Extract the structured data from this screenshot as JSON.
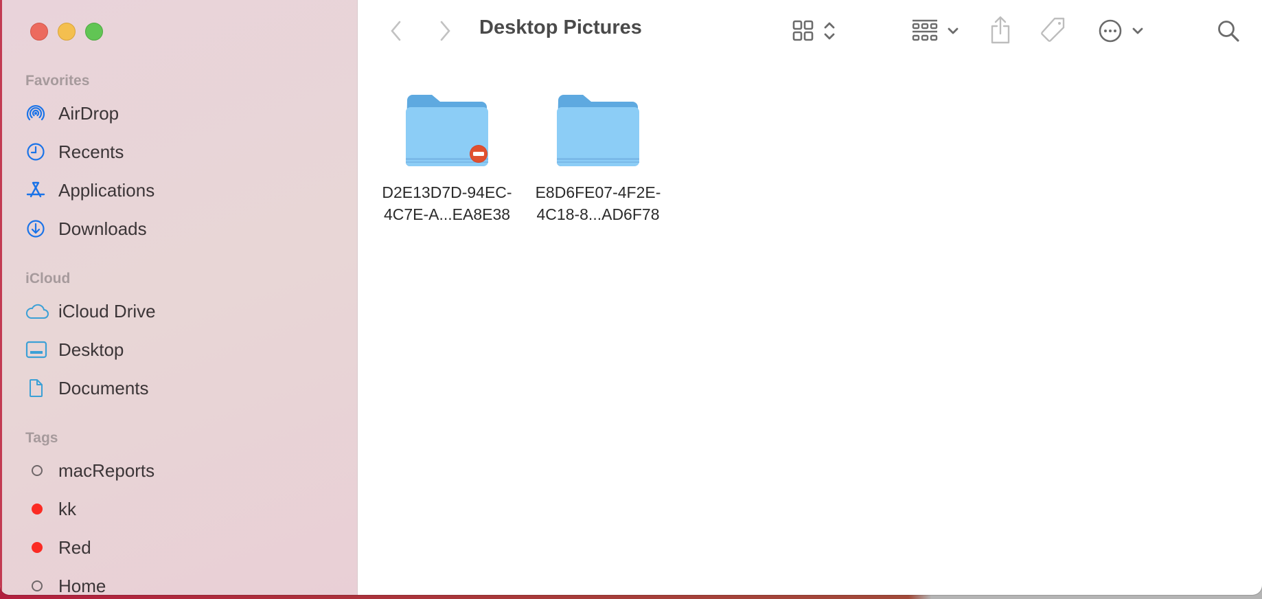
{
  "window": {
    "title": "Desktop Pictures",
    "traffic_lights": {
      "close": "#ec6a5e",
      "minimize": "#f4bf4f",
      "maximize": "#61c554"
    }
  },
  "toolbar": {
    "back_icon": "chevron-left-icon",
    "forward_icon": "chevron-right-icon",
    "view_icon": "grid-view-icon",
    "group_icon": "group-by-icon",
    "share_icon": "share-icon",
    "tag_icon": "tag-icon",
    "more_icon": "ellipsis-circle-icon",
    "search_icon": "search-icon"
  },
  "sidebar": {
    "sections": [
      {
        "label": "Favorites",
        "items": [
          {
            "label": "AirDrop",
            "icon": "airdrop-icon"
          },
          {
            "label": "Recents",
            "icon": "clock-icon"
          },
          {
            "label": "Applications",
            "icon": "applications-icon"
          },
          {
            "label": "Downloads",
            "icon": "download-icon"
          }
        ]
      },
      {
        "label": "iCloud",
        "items": [
          {
            "label": "iCloud Drive",
            "icon": "cloud-icon"
          },
          {
            "label": "Desktop",
            "icon": "desktop-icon"
          },
          {
            "label": "Documents",
            "icon": "document-icon"
          }
        ]
      },
      {
        "label": "Tags",
        "items": [
          {
            "label": "macReports",
            "color": "none"
          },
          {
            "label": "kk",
            "color": "#fb2b24"
          },
          {
            "label": "Red",
            "color": "#fb2b24"
          },
          {
            "label": "Home",
            "color": "none"
          }
        ]
      }
    ]
  },
  "files": [
    {
      "name": "D2E13D7D-94EC-\n4C7E-A...EA8E38",
      "badge": "no-access-icon"
    },
    {
      "name": "E8D6FE07-4F2E-\n4C18-8...AD6F78",
      "badge": null
    }
  ],
  "colors": {
    "accent": "#1a73e8",
    "folder": "#8ccdf6",
    "folder_dark": "#5ea9e0"
  }
}
